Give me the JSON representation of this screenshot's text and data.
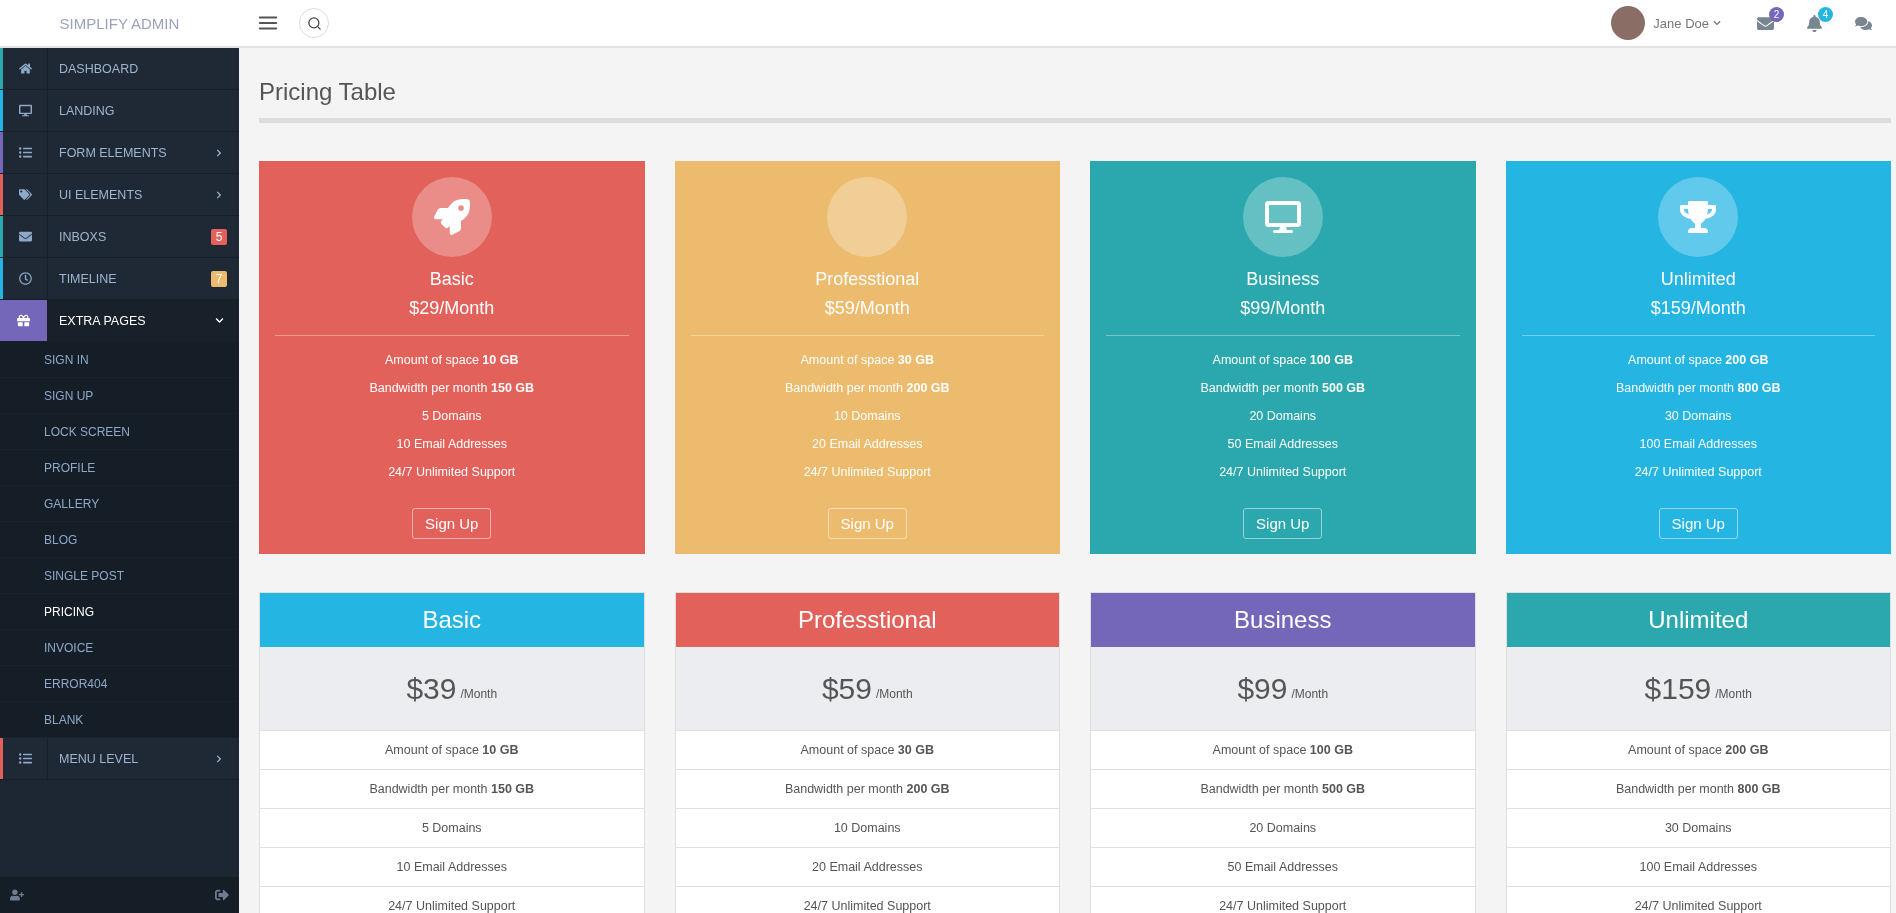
{
  "brand": "SIMPLIFY ADMIN",
  "user": {
    "name": "Jane Doe"
  },
  "notifications": [
    {
      "kind": "mail",
      "count": "2",
      "color": "#7467ba"
    },
    {
      "kind": "bell",
      "count": "4",
      "color": "#24b5e3"
    },
    {
      "kind": "chat"
    }
  ],
  "sidebar": {
    "items": [
      {
        "kind": "home",
        "label": "DASHBOARD",
        "color": "#2aa8ad",
        "selected": false,
        "has_submenu": false
      },
      {
        "kind": "desktop",
        "label": "LANDING",
        "color": "#24b5e3",
        "selected": false,
        "has_submenu": false
      },
      {
        "kind": "list",
        "label": "FORM ELEMENTS",
        "color": "#7467ba",
        "selected": false,
        "has_submenu": true
      },
      {
        "kind": "tags",
        "label": "UI ELEMENTS",
        "color": "#e2615a",
        "selected": false,
        "has_submenu": true
      },
      {
        "kind": "mail",
        "label": "INBOXS",
        "color": "#2aa8ad",
        "selected": false,
        "has_submenu": false,
        "badge": {
          "text": "5",
          "color": "#e2615a"
        }
      },
      {
        "kind": "clock",
        "label": "TIMELINE",
        "color": "#24b5e3",
        "selected": false,
        "has_submenu": false,
        "badge": {
          "text": "7",
          "color": "#ecbb6d"
        }
      },
      {
        "kind": "gift",
        "label": "EXTRA PAGES",
        "color": "#7467ba",
        "selected": true,
        "has_submenu": true,
        "expanded": true,
        "children": [
          {
            "label": "SIGN IN",
            "selected": false
          },
          {
            "label": "SIGN UP",
            "selected": false
          },
          {
            "label": "LOCK SCREEN",
            "selected": false
          },
          {
            "label": "PROFILE",
            "selected": false
          },
          {
            "label": "GALLERY",
            "selected": false
          },
          {
            "label": "BLOG",
            "selected": false
          },
          {
            "label": "SINGLE POST",
            "selected": false
          },
          {
            "label": "PRICING",
            "selected": true
          },
          {
            "label": "INVOICE",
            "selected": false
          },
          {
            "label": "ERROR404",
            "selected": false
          },
          {
            "label": "BLANK",
            "selected": false
          }
        ]
      },
      {
        "kind": "list",
        "label": "MENU LEVEL",
        "color": "#e2615a",
        "selected": false,
        "has_submenu": true
      }
    ]
  },
  "page_title": "Pricing Table",
  "icon_plans": [
    {
      "kind": "rocket",
      "name": "Basic",
      "price": "$29/Month",
      "color": "#e2615a",
      "features": [
        "Amount of space **10 GB**",
        "Bandwidth per month **150 GB**",
        "5 Domains",
        "10 Email Addresses",
        "24/7 Unlimited Support"
      ],
      "button": "Sign Up"
    },
    {
      "kind": "empty",
      "name": "Professtional",
      "price": "$59/Month",
      "color": "#ecbb6d",
      "features": [
        "Amount of space **30 GB**",
        "Bandwidth per month **200 GB**",
        "10 Domains",
        "20 Email Addresses",
        "24/7 Unlimited Support"
      ],
      "button": "Sign Up"
    },
    {
      "kind": "desktop",
      "name": "Business",
      "price": "$99/Month",
      "color": "#2aa8ad",
      "features": [
        "Amount of space **100 GB**",
        "Bandwidth per month **500 GB**",
        "20 Domains",
        "50 Email Addresses",
        "24/7 Unlimited Support"
      ],
      "button": "Sign Up"
    },
    {
      "kind": "trophy",
      "name": "Unlimited",
      "price": "$159/Month",
      "color": "#24b5e3",
      "features": [
        "Amount of space **200 GB**",
        "Bandwidth per month **800 GB**",
        "30 Domains",
        "100 Email Addresses",
        "24/7 Unlimited Support"
      ],
      "button": "Sign Up"
    }
  ],
  "table_plans": [
    {
      "name": "Basic",
      "amount": "$39",
      "period": "/Month",
      "color": "#24b5e3",
      "features": [
        "Amount of space **10 GB**",
        "Bandwidth per month **150 GB**",
        "5 Domains",
        "10 Email Addresses",
        "24/7 Unlimited Support"
      ]
    },
    {
      "name": "Professtional",
      "amount": "$59",
      "period": "/Month",
      "color": "#e2615a",
      "features": [
        "Amount of space **30 GB**",
        "Bandwidth per month **200 GB**",
        "10 Domains",
        "20 Email Addresses",
        "24/7 Unlimited Support"
      ]
    },
    {
      "name": "Business",
      "amount": "$99",
      "period": "/Month",
      "color": "#7467ba",
      "features": [
        "Amount of space **100 GB**",
        "Bandwidth per month **500 GB**",
        "20 Domains",
        "50 Email Addresses",
        "24/7 Unlimited Support"
      ]
    },
    {
      "name": "Unlimited",
      "amount": "$159",
      "period": "/Month",
      "color": "#2aa8ad",
      "features": [
        "Amount of space **200 GB**",
        "Bandwidth per month **800 GB**",
        "30 Domains",
        "100 Email Addresses",
        "24/7 Unlimited Support"
      ]
    }
  ]
}
